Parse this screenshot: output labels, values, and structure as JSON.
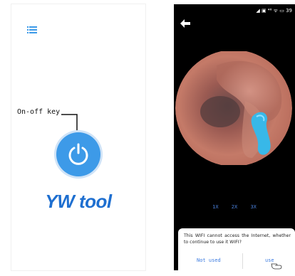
{
  "left_screen": {
    "menu_icon": "menu-icon",
    "key_label": "On-off key",
    "power_icon": "power-icon",
    "app_title": "YW tool",
    "colors": {
      "accent": "#3d9ae8",
      "title": "#1e6fd0"
    }
  },
  "right_screen": {
    "status_bar": "◢ ▣ ⁴⁶ ᯤ ▭ 39",
    "back_icon": "back-arrow-icon",
    "zoom_options": [
      "1X",
      "2X",
      "3X"
    ],
    "dialog": {
      "message": "This WIFI cannot access the Internet, whether to continue to use it WIFI?",
      "not_used_label": "Not used",
      "use_label": "use"
    },
    "colors": {
      "background": "#000000",
      "link": "#3c7be0"
    }
  }
}
